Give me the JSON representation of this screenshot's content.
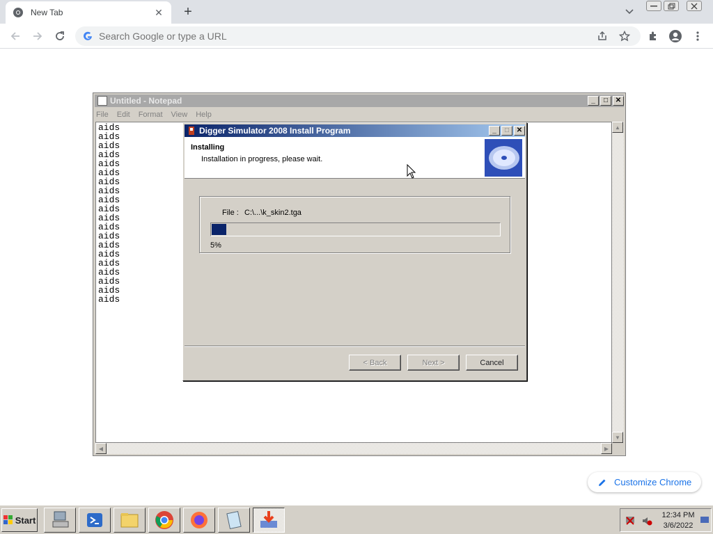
{
  "browser": {
    "tab_title": "New Tab",
    "omnibox_placeholder": "Search Google or type a URL",
    "customize_label": "Customize Chrome"
  },
  "notepad": {
    "title": "Untitled - Notepad",
    "menu": [
      "File",
      "Edit",
      "Format",
      "View",
      "Help"
    ],
    "text": "aids\naids\naids\naids\naids\naids\naids\naids\naids\naids\naids\naids\naids\naids\naids\naids\naids\naids\naids\naids"
  },
  "installer": {
    "title": "Digger Simulator 2008 Install Program",
    "heading": "Installing",
    "subheading": "Installation in progress, please wait.",
    "file_label": "File :",
    "file_value": "C:\\...\\k_skin2.tga",
    "progress": 0.05,
    "progress_text": "5%",
    "back_label": "< Back",
    "next_label": "Next >",
    "cancel_label": "Cancel"
  },
  "taskbar": {
    "start_label": "Start",
    "time": "12:34 PM",
    "date": "3/6/2022"
  }
}
